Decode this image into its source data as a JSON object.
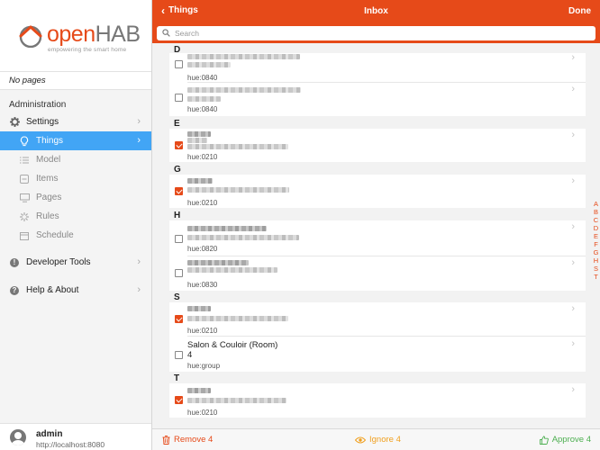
{
  "brand": {
    "name_open": "open",
    "name_hab": "HAB",
    "tagline": "empowering the smart home"
  },
  "sidebar": {
    "no_pages": "No pages",
    "admin_title": "Administration",
    "items": [
      {
        "label": "Settings",
        "icon": "gear-icon"
      },
      {
        "label": "Things",
        "icon": "lightbulb-icon",
        "active": true
      },
      {
        "label": "Model",
        "icon": "list-icon"
      },
      {
        "label": "Items",
        "icon": "items-icon"
      },
      {
        "label": "Pages",
        "icon": "monitor-icon"
      },
      {
        "label": "Rules",
        "icon": "spinner-icon"
      },
      {
        "label": "Schedule",
        "icon": "calendar-icon"
      },
      {
        "label": "Developer Tools",
        "icon": "exclamation-icon"
      },
      {
        "label": "Help & About",
        "icon": "question-icon"
      }
    ],
    "user": {
      "name": "admin",
      "url": "http://localhost:8080"
    }
  },
  "navbar": {
    "back_label": "Things",
    "title": "Inbox",
    "done_label": "Done"
  },
  "search": {
    "placeholder": "Search"
  },
  "groups": [
    "D",
    "E",
    "G",
    "H",
    "S",
    "T"
  ],
  "items": [
    {
      "sub": "hue:0840",
      "checked": false
    },
    {
      "sub": "hue:0840",
      "checked": false
    },
    {
      "sub": "hue:0210",
      "checked": true
    },
    {
      "sub": "hue:0210",
      "checked": true
    },
    {
      "sub": "hue:0820",
      "checked": false
    },
    {
      "sub": "hue:0830",
      "checked": false
    },
    {
      "sub": "hue:0210",
      "checked": true
    },
    {
      "title": "Salon & Couloir (Room)",
      "num": "4",
      "sub": "hue:group",
      "checked": false
    },
    {
      "sub": "hue:0210",
      "checked": true
    }
  ],
  "index_letters": [
    "A",
    "B",
    "C",
    "D",
    "E",
    "F",
    "G",
    "H",
    "S",
    "T"
  ],
  "toolbar": {
    "remove": "Remove 4",
    "ignore": "Ignore 4",
    "approve": "Approve 4"
  },
  "colors": {
    "accent": "#e64a19",
    "active": "#42a5f5",
    "approve": "#4caf50",
    "ignore": "#f0a020"
  }
}
